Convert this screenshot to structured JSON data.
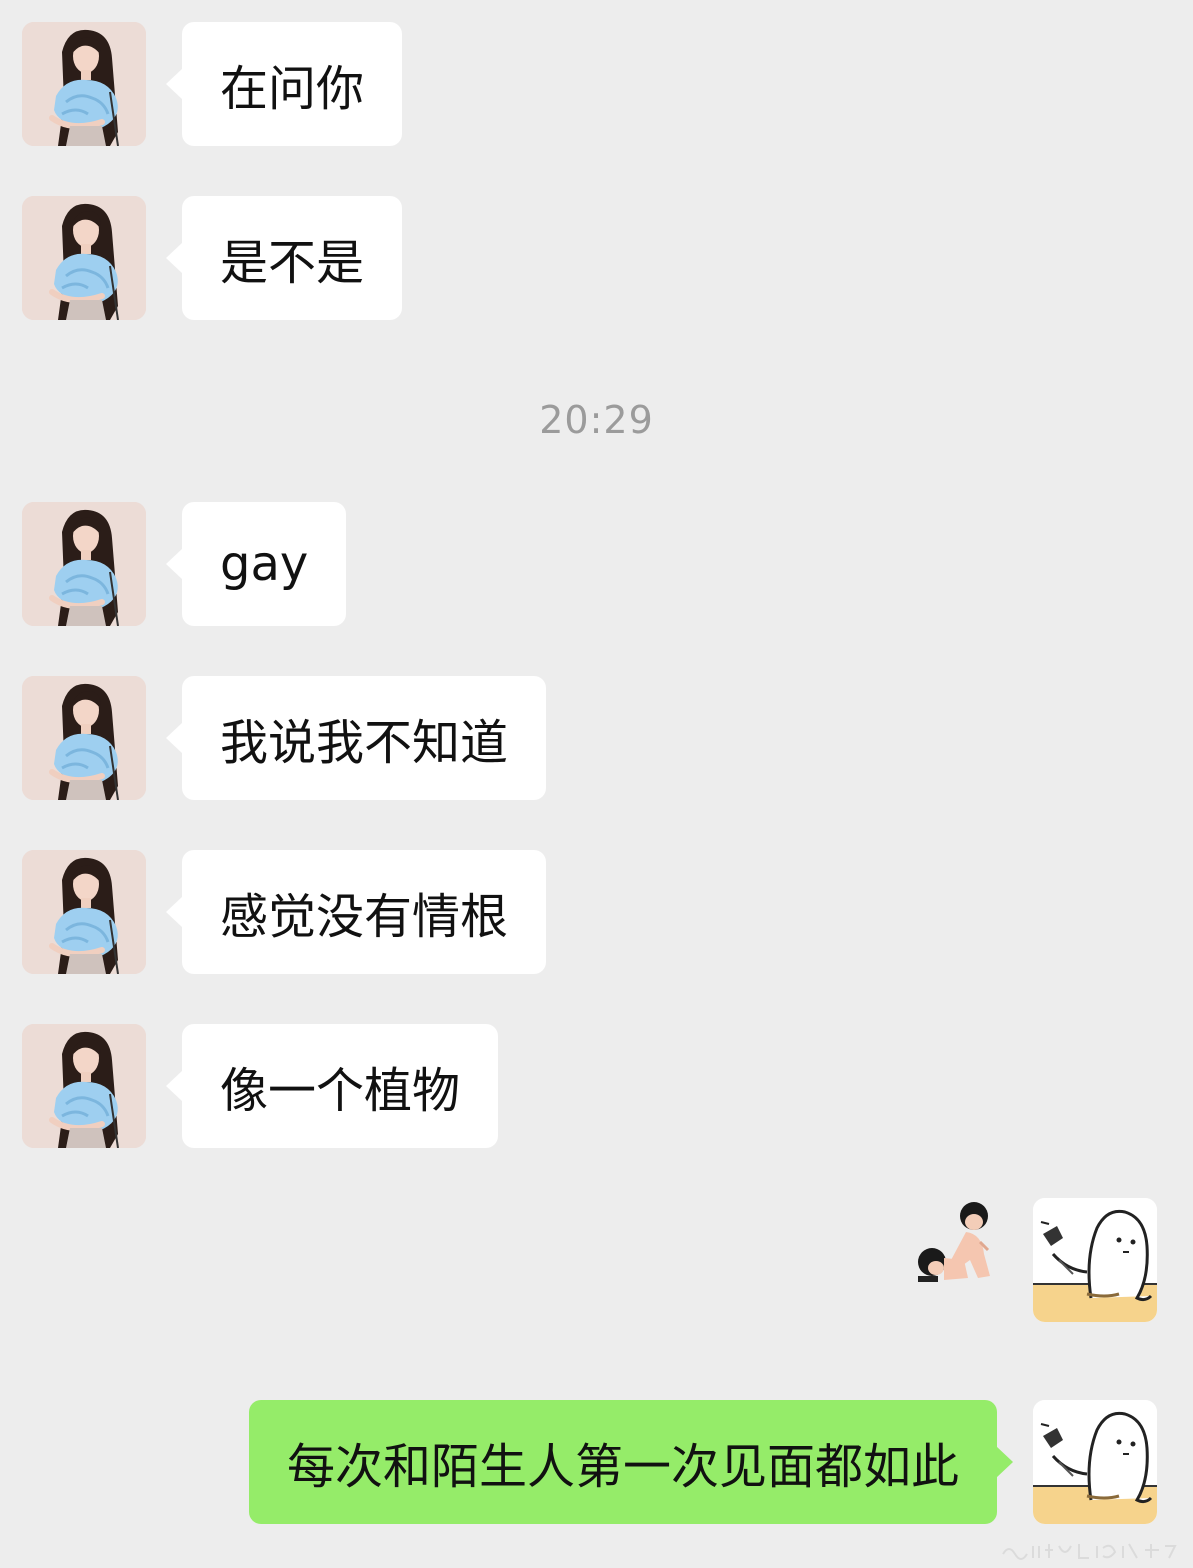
{
  "chat": {
    "timestamp": "20:29",
    "messages": [
      {
        "text": "在问你"
      },
      {
        "text": "是不是"
      },
      {
        "text": "gay"
      },
      {
        "text": "我说我不知道"
      },
      {
        "text": "感觉没有情根"
      },
      {
        "text": "像一个植物"
      },
      {
        "text": "每次和陌生人第一次见面都如此"
      }
    ]
  },
  "colors": {
    "background": "#ededed",
    "incoming_bubble": "#ffffff",
    "outgoing_bubble": "#95ec69",
    "timestamp": "#9b9b9b"
  },
  "icons": {
    "contact_avatar": "girl-portrait-avatar",
    "self_avatar": "ghost-doodle-avatar",
    "sticker": "two-figures-sticker"
  }
}
